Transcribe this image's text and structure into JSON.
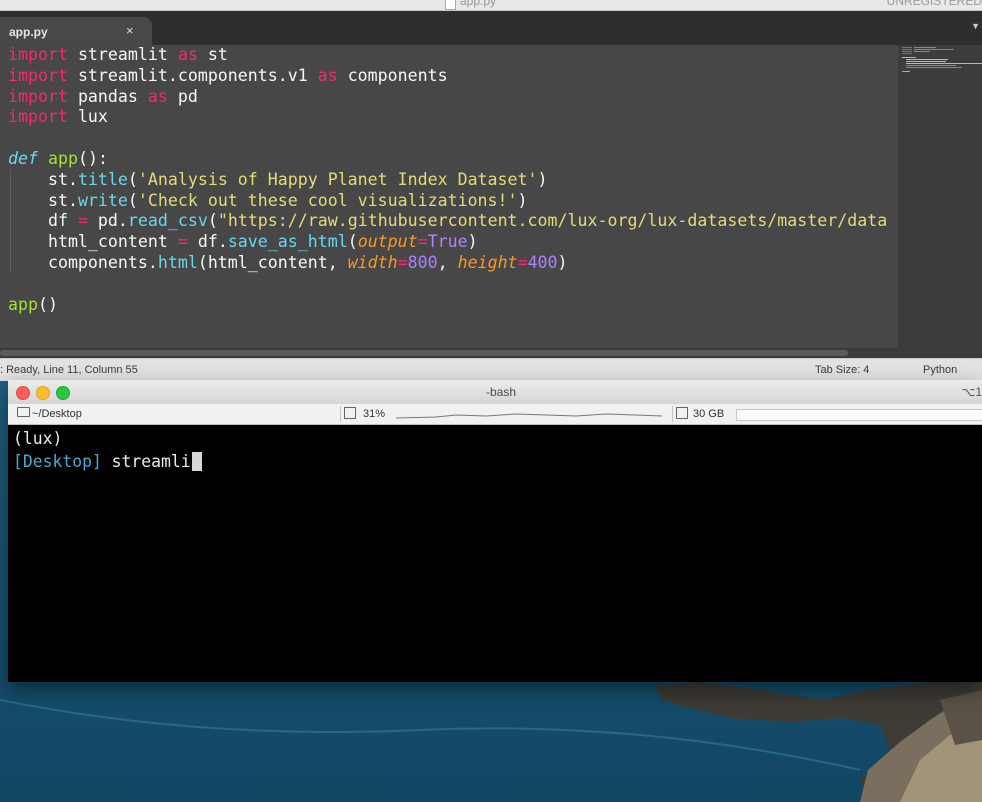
{
  "editor": {
    "window_title": "app.py",
    "unregistered": "UNREGISTERED",
    "tab_label": "app.py",
    "tab_close": "×",
    "tab_menu": "▼",
    "code_lines": [
      [
        {
          "t": "import",
          "c": "kw"
        },
        {
          "t": " streamlit "
        },
        {
          "t": "as",
          "c": "kw"
        },
        {
          "t": " st"
        }
      ],
      [
        {
          "t": "import",
          "c": "kw"
        },
        {
          "t": " streamlit.components.v1 "
        },
        {
          "t": "as",
          "c": "kw"
        },
        {
          "t": " components"
        }
      ],
      [
        {
          "t": "import",
          "c": "kw"
        },
        {
          "t": " pandas "
        },
        {
          "t": "as",
          "c": "kw"
        },
        {
          "t": " pd"
        }
      ],
      [
        {
          "t": "import",
          "c": "kw"
        },
        {
          "t": " lux"
        }
      ],
      [],
      [
        {
          "t": "def",
          "c": "def"
        },
        {
          "t": " "
        },
        {
          "t": "app",
          "c": "fn"
        },
        {
          "t": "():"
        }
      ],
      [
        {
          "t": "    st."
        },
        {
          "t": "title",
          "c": "bi"
        },
        {
          "t": "("
        },
        {
          "t": "'Analysis of Happy Planet Index Dataset'",
          "c": "str"
        },
        {
          "t": ")"
        }
      ],
      [
        {
          "t": "    st."
        },
        {
          "t": "write",
          "c": "bi"
        },
        {
          "t": "("
        },
        {
          "t": "'Check out these cool visualizations!'",
          "c": "str"
        },
        {
          "t": ")"
        }
      ],
      [
        {
          "t": "    df "
        },
        {
          "t": "=",
          "c": "kw"
        },
        {
          "t": " pd."
        },
        {
          "t": "read_csv",
          "c": "bi"
        },
        {
          "t": "("
        },
        {
          "t": "\"https://raw.githubusercontent.com/lux-org/lux-datasets/master/data",
          "c": "str"
        }
      ],
      [
        {
          "t": "    html_content "
        },
        {
          "t": "=",
          "c": "kw"
        },
        {
          "t": " df."
        },
        {
          "t": "save_as_html",
          "c": "bi"
        },
        {
          "t": "("
        },
        {
          "t": "output",
          "c": "arg"
        },
        {
          "t": "=",
          "c": "kw"
        },
        {
          "t": "True",
          "c": "num"
        },
        {
          "t": ")"
        }
      ],
      [
        {
          "t": "    components."
        },
        {
          "t": "html",
          "c": "bi"
        },
        {
          "t": "(html_content, "
        },
        {
          "t": "width",
          "c": "arg"
        },
        {
          "t": "=",
          "c": "kw"
        },
        {
          "t": "800",
          "c": "num"
        },
        {
          "t": ", "
        },
        {
          "t": "height",
          "c": "arg"
        },
        {
          "t": "=",
          "c": "kw"
        },
        {
          "t": "400",
          "c": "num"
        },
        {
          "t": ")"
        }
      ],
      [],
      [
        {
          "t": "app",
          "c": "fn"
        },
        {
          "t": "()"
        }
      ]
    ],
    "status": {
      "left": ": Ready, Line 11, Column 55",
      "tab_size": "Tab Size: 4",
      "language": "Python"
    }
  },
  "terminal": {
    "title": "-bash",
    "shortcut": "⌥1",
    "path": "~/Desktop",
    "cpu": "31%",
    "memory": "30 GB",
    "line1": "(lux)",
    "prompt": "[Desktop]",
    "command": " streamli"
  },
  "colors": {
    "editor_bg": "#474747",
    "terminal_bg": "#000000",
    "prompt": "#4aa8d4",
    "traffic_close": "#fc5f57",
    "traffic_min": "#fdbc2e",
    "traffic_max": "#28c840"
  }
}
